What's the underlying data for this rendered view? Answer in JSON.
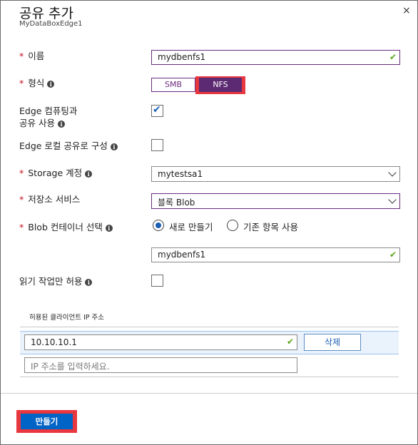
{
  "header": {
    "title": "공유 추가",
    "subtitle": "MyDataBoxEdge1",
    "close_icon": "×"
  },
  "form": {
    "name": {
      "label": "이름",
      "required_mark": "*",
      "value": "mydbenfs1"
    },
    "type": {
      "label": "형식",
      "required_mark": "*",
      "options": [
        "SMB",
        "NFS"
      ],
      "selected": "NFS"
    },
    "edge_compute": {
      "label_line1": "Edge 컴퓨팅과",
      "label_line2": "공유 사용",
      "checked": true
    },
    "edge_local": {
      "label": "Edge 로컬 공유로 구성",
      "checked": false
    },
    "storage_account": {
      "label": "Storage 계정",
      "required_mark": "*",
      "value": "mytestsa1"
    },
    "storage_service": {
      "label": "저장소 서비스",
      "required_mark": "*",
      "value": "블록 Blob"
    },
    "blob_container": {
      "label": "Blob 컨테이너 선택",
      "required_mark": "*",
      "option_new": "새로 만들기",
      "option_existing": "기존 항목 사용",
      "selected": "새로 만들기",
      "value": "mydbenfs1"
    },
    "read_only": {
      "label": "읽기 작업만 허용",
      "checked": false
    },
    "allowed_clients": {
      "section_label": "허용된 클라이언트 IP 주소",
      "ip_value": "10.10.10.1",
      "delete_label": "삭제",
      "placeholder": "IP 주소를 입력하세요."
    }
  },
  "footer": {
    "create_label": "만들기"
  },
  "colors": {
    "accent": "#6b2c7e",
    "primary_button": "#0063c6",
    "highlight": "#e8373f",
    "valid_check": "#5ba51c"
  }
}
